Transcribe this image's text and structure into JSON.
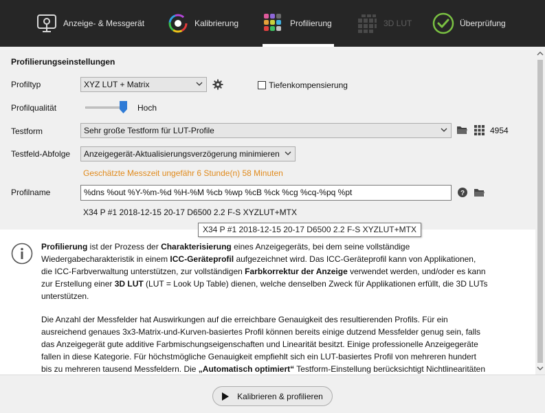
{
  "nav": {
    "tabs": [
      {
        "label": "Anzeige- & Messgerät",
        "icon": "display-device-icon",
        "active": false,
        "disabled": false
      },
      {
        "label": "Kalibrierung",
        "icon": "calibration-ring-icon",
        "active": false,
        "disabled": false
      },
      {
        "label": "Profilierung",
        "icon": "color-grid-icon",
        "active": true,
        "disabled": false
      },
      {
        "label": "3D LUT",
        "icon": "lut-cube-icon",
        "active": false,
        "disabled": true
      },
      {
        "label": "Überprüfung",
        "icon": "check-circle-icon",
        "active": false,
        "disabled": false
      }
    ]
  },
  "settings": {
    "title": "Profilierungseinstellungen",
    "profile_type": {
      "label": "Profiltyp",
      "value": "XYZ LUT + Matrix"
    },
    "depth_compensation": {
      "label": "Tiefenkompensierung",
      "checked": false
    },
    "profile_quality": {
      "label": "Profilqualität",
      "value_label": "Hoch",
      "level": 0.92
    },
    "testchart": {
      "label": "Testform",
      "value": "Sehr große Testform für LUT-Profile",
      "patch_count": "4954"
    },
    "patch_sequence": {
      "label": "Testfeld-Abfolge",
      "value": "Anzeigegerät-Aktualisierungsverzögerung minimieren"
    },
    "estimated_time": "Geschätzte Messzeit ungefähr 6 Stunde(n) 58 Minuten",
    "profile_name": {
      "label": "Profilname",
      "value": "%dns %out %Y-%m-%d %H-%M %cb %wp %cB %ck %cg %cq-%pq %pt",
      "preview": "X34 P #1 2018-12-15 20-17 D6500 2.2 F-S XYZLUT+MTX"
    }
  },
  "tooltip": "X34 P #1 2018-12-15 20-17 D6500 2.2 F-S XYZLUT+MTX",
  "info": {
    "p1": [
      {
        "t": "Profilierung",
        "b": true
      },
      {
        "t": " ist der Prozess der ",
        "b": false
      },
      {
        "t": "Charakterisierung",
        "b": true
      },
      {
        "t": " eines Anzeigegeräts, bei dem seine vollständige Wiedergabecharakteristik in einem ",
        "b": false
      },
      {
        "t": "ICC-Geräteprofil",
        "b": true
      },
      {
        "t": " aufgezeichnet wird. Das ICC-Geräteprofil kann von Applikationen, die ICC-Farbverwaltung unterstützen, zur vollständigen ",
        "b": false
      },
      {
        "t": "Farbkorrektur der Anzeige",
        "b": true
      },
      {
        "t": " verwendet werden, und/oder es kann zur Erstellung einer ",
        "b": false
      },
      {
        "t": "3D LUT",
        "b": true
      },
      {
        "t": " (LUT = Look Up Table) dienen, welche denselben Zweck für Applikationen erfüllt, die 3D LUTs unterstützen.",
        "b": false
      }
    ],
    "p2": [
      {
        "t": "Die Anzahl der Messfelder hat Auswirkungen auf die erreichbare Genauigkeit des resultierenden Profils. Für ein ausreichend genaues 3x3-Matrix-und-Kurven-basiertes Profil können bereits einige dutzend Messfelder genug sein, falls das Anzeigegerät gute additive Farbmischungseigenschaften und Linearität besitzt. Einige professionelle Anzeigegeräte fallen in diese Kategorie. Für höchstmögliche Genauigkeit empfiehlt sich ein LUT-basiertes Profil von mehreren hundert bis zu mehreren tausend Messfeldern. Die ",
        "b": false
      },
      {
        "t": "„Automatisch optimiert“",
        "b": true
      },
      {
        "t": " Testform-Einstellung berücksichtigt Nichtlinearitäten",
        "b": false
      }
    ]
  },
  "footer": {
    "primary_button": "Kalibrieren & profilieren"
  },
  "colors": {
    "topbar": "#262626",
    "accent_blue": "#2e7bd6",
    "warning": "#e08a1c",
    "check_green": "#7ac142"
  }
}
